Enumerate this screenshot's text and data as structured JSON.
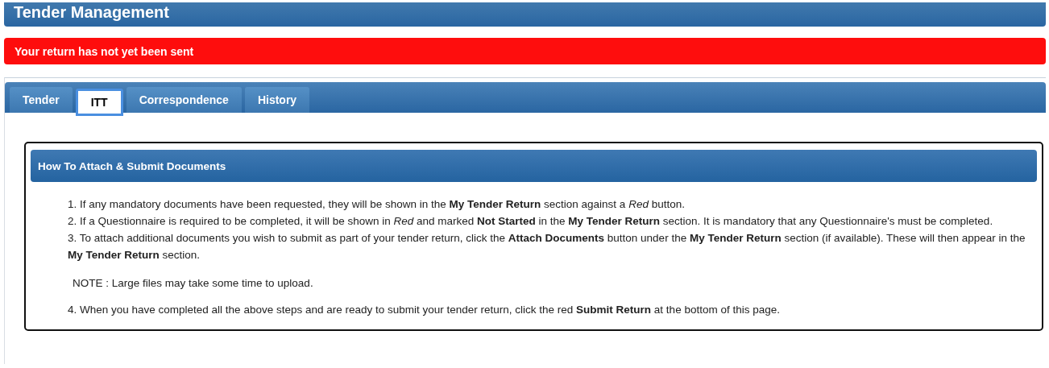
{
  "header": {
    "title": "Tender Management"
  },
  "alert": {
    "text": "Your return has not yet been sent"
  },
  "tabs": [
    {
      "label": "Tender",
      "selected": false
    },
    {
      "label": "ITT",
      "selected": true
    },
    {
      "label": "Correspondence",
      "selected": false
    },
    {
      "label": "History",
      "selected": false
    }
  ],
  "instructions": {
    "title": "How To Attach & Submit Documents",
    "items": [
      {
        "kind": "step",
        "text": "1. If any mandatory documents have been requested, they will be shown in the **My Tender Return** section against a *Red* button."
      },
      {
        "kind": "step",
        "text": "2. If a Questionnaire is required to be completed, it will be shown in *Red* and marked **Not Started** in the **My Tender Return** section. It is mandatory that any Questionnaire's must be completed."
      },
      {
        "kind": "step",
        "text": "3. To attach additional documents you wish to submit as part of your tender return, click the **Attach Documents** button under the **My Tender Return** section (if available). These will then appear in the **My Tender Return** section."
      },
      {
        "kind": "note",
        "text": "NOTE : Large files may take some time to upload."
      },
      {
        "kind": "step",
        "text": "4. When you have completed all the above steps and are ready to submit your tender return, click the red **Submit Return** at the bottom of this page."
      }
    ]
  }
}
